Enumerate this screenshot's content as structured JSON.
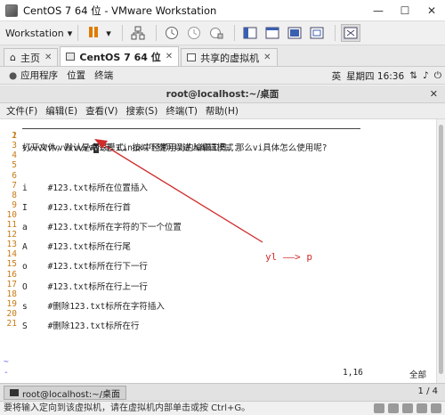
{
  "window": {
    "title": "CentOS 7 64 位 - VMware Workstation"
  },
  "toolbar": {
    "workstation_label": "Workstation"
  },
  "tabs": [
    {
      "label": "主页"
    },
    {
      "label": "CentOS 7 64 位"
    },
    {
      "label": "共享的虚拟机"
    }
  ],
  "gnome": {
    "applications": "应用程序",
    "places": "位置",
    "terminal": "终端",
    "lang": "英",
    "clock": "星期四 16:36"
  },
  "terminal": {
    "title": "root@localhost:~/桌面",
    "menu": [
      "文件(F)",
      "编辑(E)",
      "查看(V)",
      "搜索(S)",
      "终端(T)",
      "帮助(H)"
    ]
  },
  "editor": {
    "line1_prefix": "vvvvvvvvvvvvvv",
    "line1_cursor": "v",
    "line1_rest": "i是 Linux中经常用到的编辑工具，那么vi具体怎么使用呢?",
    "lines": [
      {
        "num": "2",
        "text": ""
      },
      {
        "num": "3",
        "text": "打开文件，默认是命令模式。按以下键可以进入编辑模式："
      },
      {
        "num": "4",
        "text": ""
      },
      {
        "num": "5",
        "text": ""
      },
      {
        "num": "6",
        "text": ""
      },
      {
        "num": "7",
        "text": "i    #123.txt标所在位置插入"
      },
      {
        "num": "8",
        "text": ""
      },
      {
        "num": "9",
        "text": "I    #123.txt标所在行首"
      },
      {
        "num": "10",
        "text": ""
      },
      {
        "num": "11",
        "text": "a    #123.txt标所在字符的下一个位置"
      },
      {
        "num": "12",
        "text": ""
      },
      {
        "num": "13",
        "text": "A    #123.txt标所在行尾"
      },
      {
        "num": "14",
        "text": ""
      },
      {
        "num": "15",
        "text": "o    #123.txt标所在行下一行"
      },
      {
        "num": "16",
        "text": ""
      },
      {
        "num": "17",
        "text": "O    #123.txt标所在行上一行"
      },
      {
        "num": "18",
        "text": ""
      },
      {
        "num": "19",
        "text": "s    #删除123.txt标所在字符插入"
      },
      {
        "num": "20",
        "text": ""
      },
      {
        "num": "21",
        "text": "S    #删除123.txt标所在行"
      }
    ],
    "position": "1,16",
    "scroll": "全部",
    "annotation": "yl  ——>  p"
  },
  "taskbar": {
    "item": "root@localhost:~/桌面",
    "pages": "1 / 4"
  },
  "status": {
    "message": "要将输入定向到该虚拟机，请在虚拟机内部单击或按 Ctrl+G。"
  },
  "colors": {
    "line_number": "#c77a14",
    "annotation": "#d12b2b",
    "arrow": "#d12b2b"
  }
}
